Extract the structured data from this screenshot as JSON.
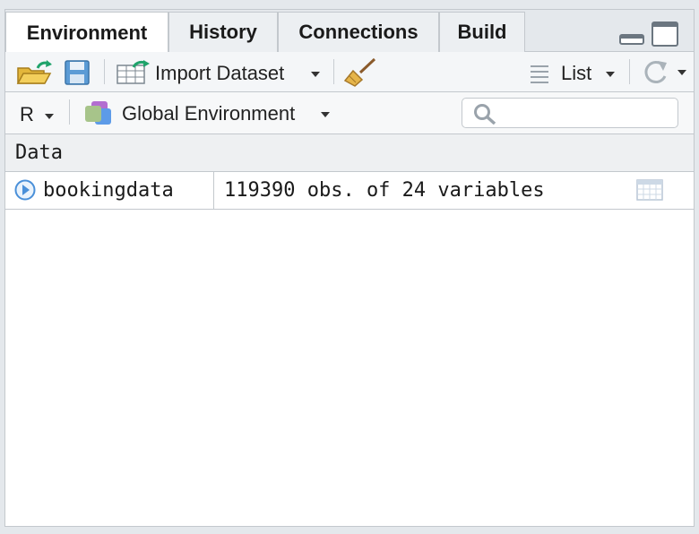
{
  "tabs": [
    {
      "label": "Environment",
      "active": true
    },
    {
      "label": "History",
      "active": false
    },
    {
      "label": "Connections",
      "active": false
    },
    {
      "label": "Build",
      "active": false
    }
  ],
  "toolbar": {
    "open_icon": "folder-open-icon",
    "save_icon": "save-icon",
    "import_label": "Import Dataset",
    "clear_icon": "broom-icon",
    "view_label": "List",
    "refresh_icon": "refresh-icon"
  },
  "env_bar": {
    "language": "R",
    "environment_label": "Global Environment",
    "search_placeholder": ""
  },
  "section": {
    "title": "Data"
  },
  "data_rows": [
    {
      "name": "bookingdata",
      "value": "119390 obs. of 24 variables"
    }
  ],
  "colors": {
    "accent": "#4a90d9",
    "border": "#c3c8cd",
    "tabbar_bg": "#e4e8ec"
  }
}
